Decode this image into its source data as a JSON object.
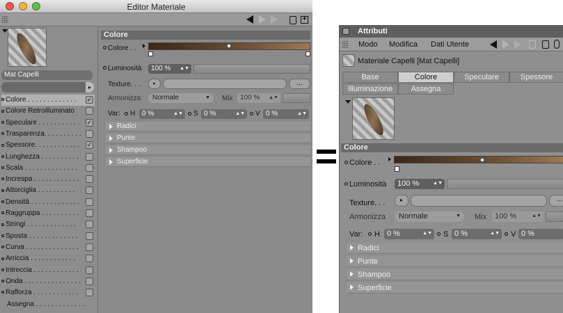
{
  "left_window": {
    "title": "Editor Materiale",
    "material_name": "Mat Capelli",
    "channels": [
      {
        "label": "Colore . . . . . . . . . . . . .",
        "checked": true,
        "selected": true
      },
      {
        "label": "Colore Retroilluminato",
        "checked": false
      },
      {
        "label": "Speculare . . . . . . . . . . .",
        "checked": true
      },
      {
        "label": "Trasparenza. . . . . . . . . .",
        "checked": false
      },
      {
        "label": "Spessore. . . . . . . . . . . .",
        "checked": true
      },
      {
        "label": "Lunghezza . . . . . . . . . .",
        "checked": false
      },
      {
        "label": "Scala . . . . . . . . . . . . . .",
        "checked": false
      },
      {
        "label": "Increspa . . . . . . . . . . . .",
        "checked": false
      },
      {
        "label": "Attorciglia . . . . . . . . . .",
        "checked": false
      },
      {
        "label": "Densità . . . . . . . . . . . . .",
        "checked": false
      },
      {
        "label": "Raggruppa . . . . . . . . . .",
        "checked": false
      },
      {
        "label": "Stringi . . . . . . . . . . . . .",
        "checked": false
      },
      {
        "label": "Sposta . . . . . . . . . . . . .",
        "checked": false
      },
      {
        "label": "Curva . . . . . . . . . . . . . .",
        "checked": false
      },
      {
        "label": "Arriccia . . . . . . . . . . . .",
        "checked": false
      },
      {
        "label": "Intreccia . . . . . . . . . . . .",
        "checked": false
      },
      {
        "label": "Onda . . . . . . . . . . . . . . .",
        "checked": false
      },
      {
        "label": "Rafforza . . . . . . . . . . . .",
        "checked": false
      }
    ],
    "assegna": "Assegna . . . . . . . . . . . . .",
    "section": "Colore",
    "colore_label": "Colore . .",
    "luminosita_label": "Luminosità",
    "luminosita_value": "100 %",
    "texture_label": "Texture. . .",
    "dots": "...",
    "armonizza_label": "Armonizza",
    "armonizza_value": "Normale",
    "mix_label": "Mix",
    "mix_value": "100 %",
    "var_label": "Var:",
    "h_label": "H",
    "h_value": "0 %",
    "s_label": "S",
    "s_value": "0 %",
    "v_label": "V",
    "v_value": "0 %",
    "groups": [
      "Radici",
      "Punte",
      "Shampoo",
      "Superficie"
    ]
  },
  "right_window": {
    "title": "Attributi",
    "menu": [
      "Modo",
      "Modifica",
      "Dati Utente"
    ],
    "object_name": "Materiale Capelli [Mat Capelli]",
    "tabs_row1": [
      "Base",
      "Colore",
      "Speculare",
      "Spessore"
    ],
    "tabs_row2": [
      "Illuminazione",
      "Assegna"
    ],
    "selected_tab": "Colore",
    "section": "Colore",
    "colore_label": "Colore . .",
    "luminosita_label": "Luminosità",
    "luminosita_value": "100 %",
    "texture_label": "Texture. . .",
    "dots": "...",
    "armonizza_label": "Armonizza",
    "armonizza_value": "Normale",
    "mix_label": "Mix",
    "mix_value": "100 %",
    "var_label": "Var:",
    "h_label": "H",
    "h_value": "0 %",
    "s_label": "S",
    "s_value": "0 %",
    "v_label": "V",
    "v_value": "0 %",
    "groups": [
      "Radici",
      "Punte",
      "Shampoo",
      "Superficie"
    ]
  },
  "colors": {
    "traffic_close": "#ec5b52",
    "traffic_min": "#e9b544",
    "traffic_max": "#5fbf48",
    "gradient_dark": "#3b2718",
    "gradient_light": "#9b7a55"
  },
  "icons": [
    "back-arrow-icon",
    "forward-arrow-icon",
    "lock-icon",
    "new-panel-icon",
    "grip-icon",
    "checkbox-icon"
  ]
}
